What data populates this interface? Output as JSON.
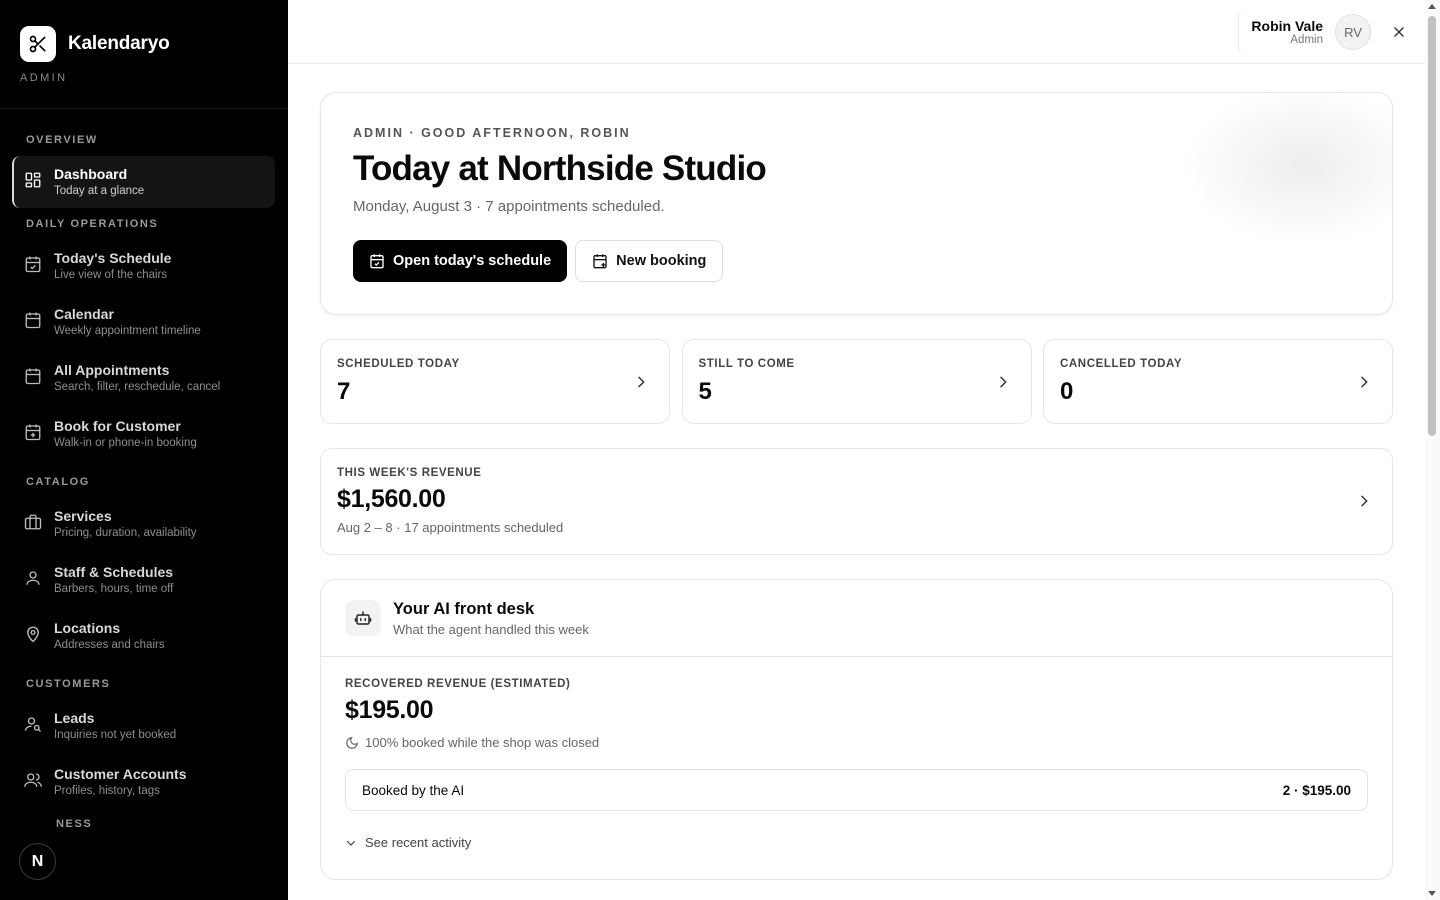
{
  "brand": {
    "name": "Kalendaryo",
    "role": "ADMIN",
    "logo_icon": "scissors-icon"
  },
  "sidebar": {
    "sections": {
      "overview": "OVERVIEW",
      "daily": "DAILY OPERATIONS",
      "catalog": "CATALOG",
      "customers": "CUSTOMERS",
      "business": "NESS"
    },
    "items": [
      {
        "label": "Dashboard",
        "desc": "Today at a glance",
        "icon": "dashboard-grid-icon",
        "active": true
      },
      {
        "label": "Today's Schedule",
        "desc": "Live view of the chairs",
        "icon": "calendar-check-icon"
      },
      {
        "label": "Calendar",
        "desc": "Weekly appointment timeline",
        "icon": "calendar-icon"
      },
      {
        "label": "All Appointments",
        "desc": "Search, filter, reschedule, cancel",
        "icon": "calendar-list-icon"
      },
      {
        "label": "Book for Customer",
        "desc": "Walk-in or phone-in booking",
        "icon": "calendar-plus-icon"
      },
      {
        "label": "Services",
        "desc": "Pricing, duration, availability",
        "icon": "briefcase-icon"
      },
      {
        "label": "Staff & Schedules",
        "desc": "Barbers, hours, time off",
        "icon": "user-icon"
      },
      {
        "label": "Locations",
        "desc": "Addresses and chairs",
        "icon": "map-pin-icon"
      },
      {
        "label": "Leads",
        "desc": "Inquiries not yet booked",
        "icon": "user-search-icon"
      },
      {
        "label": "Customer Accounts",
        "desc": "Profiles, history, tags",
        "icon": "users-icon"
      }
    ],
    "badge": "N"
  },
  "topbar": {
    "user_name": "Robin Vale",
    "user_role": "Admin",
    "initials": "RV"
  },
  "hero": {
    "kicker": "ADMIN · GOOD AFTERNOON, ROBIN",
    "title": "Today at Northside Studio",
    "subtitle": "Monday, August 3 · 7 appointments scheduled.",
    "primary_label": "Open today's schedule",
    "secondary_label": "New booking"
  },
  "stats": [
    {
      "label": "SCHEDULED TODAY",
      "value": "7"
    },
    {
      "label": "STILL TO COME",
      "value": "5"
    },
    {
      "label": "CANCELLED TODAY",
      "value": "0"
    }
  ],
  "revenue": {
    "label": "THIS WEEK'S REVENUE",
    "value": "$1,560.00",
    "sub": "Aug 2 – 8 · 17 appointments scheduled"
  },
  "ai": {
    "title": "Your AI front desk",
    "subtitle": "What the agent handled this week",
    "label": "RECOVERED REVENUE (ESTIMATED)",
    "value": "$195.00",
    "note": "100% booked while the shop was closed",
    "row_label": "Booked by the AI",
    "row_value": "2 · $195.00",
    "more_label": "See recent activity"
  },
  "colors": {
    "sidebar_bg": "#000000",
    "primary": "#000000",
    "border": "#e6e6e6"
  }
}
